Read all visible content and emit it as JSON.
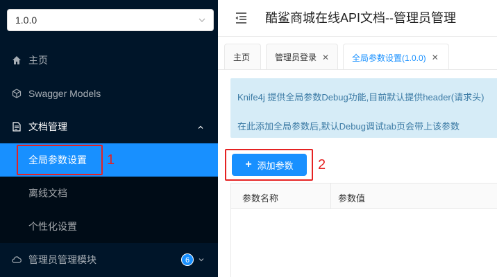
{
  "sidebar": {
    "version": "1.0.0",
    "items": [
      {
        "label": "主页",
        "icon": "home-icon"
      },
      {
        "label": "Swagger Models",
        "icon": "cube-icon"
      },
      {
        "label": "文档管理",
        "icon": "document-icon"
      },
      {
        "label": "管理员管理模块",
        "icon": "cloud-icon",
        "badge": "6"
      }
    ],
    "doc_submenu": [
      {
        "label": "全局参数设置"
      },
      {
        "label": "离线文档"
      },
      {
        "label": "个性化设置"
      }
    ]
  },
  "header": {
    "title": "酷鲨商城在线API文档--管理员管理"
  },
  "tabs": [
    {
      "label": "主页"
    },
    {
      "label": "管理员登录"
    },
    {
      "label": "全局参数设置(1.0.0)"
    }
  ],
  "alert": {
    "line1": "Knife4j 提供全局参数Debug功能,目前默认提供header(请求头)",
    "line2": "在此添加全局参数后,默认Debug调试tab页会带上该参数"
  },
  "add_button": {
    "label": "添加参数"
  },
  "table": {
    "columns": [
      "参数名称",
      "参数值"
    ]
  },
  "annotations": {
    "n1": "1",
    "n2": "2"
  },
  "colors": {
    "sidebar": "#001529",
    "accent": "#1890ff",
    "annotation": "#e52222"
  }
}
